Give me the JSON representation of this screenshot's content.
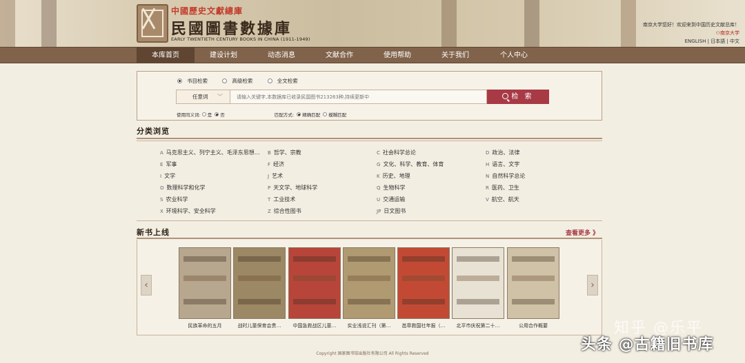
{
  "header": {
    "subtitle": "中國歷史文獻總庫",
    "title": "民國圖書數據庫",
    "english": "EARLY TWENTIETH CENTURY BOOKS IN CHINA (1911-1949)",
    "welcome": "南京大学您好！欢迎来到中国历史文献总库！",
    "user": "南京大学",
    "lang_en": "ENGLISH",
    "lang_ja": "日本語",
    "lang_zh": "中文"
  },
  "nav": [
    "本库首页",
    "建设计划",
    "动态消息",
    "文献合作",
    "使用帮助",
    "关于我们",
    "个人中心"
  ],
  "search": {
    "modes": [
      "书目检索",
      "高级检索",
      "全文检索"
    ],
    "field": "任意词",
    "placeholder": "请输入关键字,本数据库已收录民国图书213263种,持续更新中",
    "button": "检 索",
    "synonym_label": "使用同义词:",
    "synonym_yes": "是",
    "synonym_no": "否",
    "match_label": "匹配方式:",
    "match_exact": "精确匹配",
    "match_fuzzy": "模糊匹配"
  },
  "categories_title": "分类浏览",
  "categories": [
    {
      "code": "A",
      "label": "马克思主义、列宁主义、毛泽东思想…"
    },
    {
      "code": "B",
      "label": "哲学、宗教"
    },
    {
      "code": "C",
      "label": "社会科学总论"
    },
    {
      "code": "D",
      "label": "政治、法律"
    },
    {
      "code": "E",
      "label": "军事"
    },
    {
      "code": "F",
      "label": "经济"
    },
    {
      "code": "G",
      "label": "文化、科学、教育、体育"
    },
    {
      "code": "H",
      "label": "语言、文字"
    },
    {
      "code": "I",
      "label": "文学"
    },
    {
      "code": "J",
      "label": "艺术"
    },
    {
      "code": "K",
      "label": "历史、地理"
    },
    {
      "code": "N",
      "label": "自然科学总论"
    },
    {
      "code": "O",
      "label": "数理科学和化学"
    },
    {
      "code": "P",
      "label": "天文学、地球科学"
    },
    {
      "code": "Q",
      "label": "生物科学"
    },
    {
      "code": "R",
      "label": "医药、卫生"
    },
    {
      "code": "S",
      "label": "农业科学"
    },
    {
      "code": "T",
      "label": "工业技术"
    },
    {
      "code": "U",
      "label": "交通运输"
    },
    {
      "code": "V",
      "label": "航空、航天"
    },
    {
      "code": "X",
      "label": "环境科学、安全科学"
    },
    {
      "code": "Z",
      "label": "综合性图书"
    },
    {
      "code": "JP",
      "label": "日文图书"
    }
  ],
  "new_books_title": "新书上线",
  "more": "查看更多 》",
  "books": [
    {
      "title": "民族革命的五月",
      "color": "#b6a78e"
    },
    {
      "title": "战时儿童保育会贵…",
      "color": "#9c8864"
    },
    {
      "title": "中国急救战区儿童…",
      "color": "#b8453a"
    },
    {
      "title": "实业浅说汇刊（第…",
      "color": "#b09a72"
    },
    {
      "title": "邕章救国社年报（…",
      "color": "#c24a35"
    },
    {
      "title": "北平市庆祝第二十…",
      "color": "#e8e2d4"
    },
    {
      "title": "公用合作概要",
      "color": "#cfc2a6"
    }
  ],
  "footer": "Copyright 国家图书馆出版社有限公司 All Rights Reserved",
  "watermark_1": "知乎 @乐平",
  "watermark_2": "头条 @古籍旧书库"
}
